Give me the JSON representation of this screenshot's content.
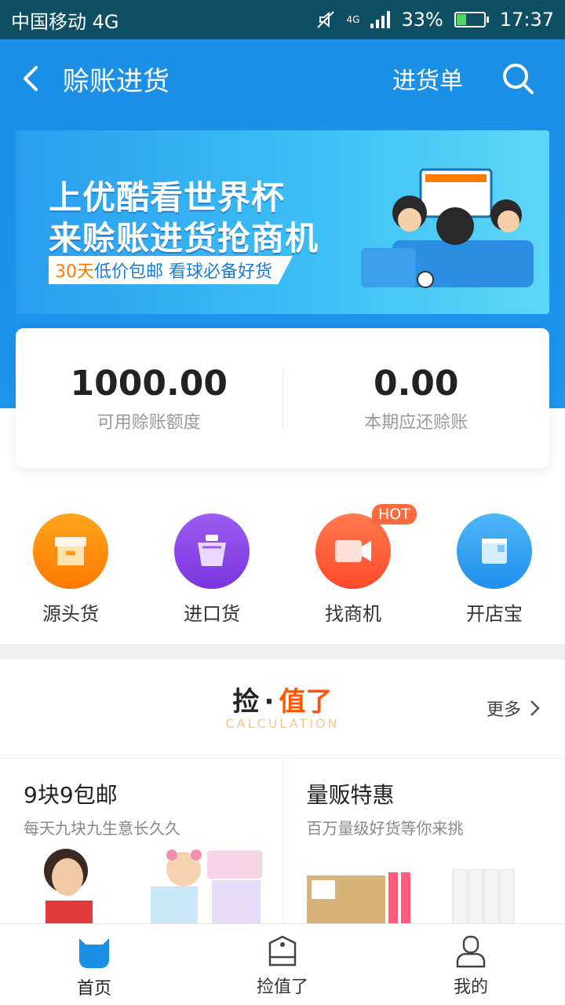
{
  "status": {
    "carrier": "中国移动 4G",
    "net": "4G",
    "battery": "33%",
    "time": "17:37"
  },
  "nav": {
    "title": "赊账进货",
    "order_label": "进货单"
  },
  "banner": {
    "line1": "上优酷看世界杯",
    "line2": "来赊账进货抢商机",
    "tag_highlight": "30天",
    "tag_rest": "低价包邮 看球必备好货"
  },
  "credit": {
    "available_value": "1000.00",
    "available_label": "可用赊账额度",
    "due_value": "0.00",
    "due_label": "本期应还赊账"
  },
  "shortcuts": [
    {
      "label": "源头货",
      "color": "#ff8c00"
    },
    {
      "label": "进口货",
      "color": "#8e47e6"
    },
    {
      "label": "找商机",
      "color": "#ff5a3c",
      "badge": "HOT"
    },
    {
      "label": "开店宝",
      "color": "#2f9ff0"
    }
  ],
  "section": {
    "title_a": "捡",
    "title_dot": "·",
    "title_b": "值了",
    "subtitle": "CALCULATION",
    "more": "更多"
  },
  "cards": [
    {
      "title": "9块9包邮",
      "subtitle": "每天九块九生意长久久"
    },
    {
      "title": "量贩特惠",
      "subtitle": "百万量级好货等你来挑"
    }
  ],
  "tabs": [
    {
      "label": "首页"
    },
    {
      "label": "捡值了"
    },
    {
      "label": "我的"
    }
  ],
  "colors": {
    "primary": "#1b8ee6",
    "accent": "#ff5500"
  }
}
